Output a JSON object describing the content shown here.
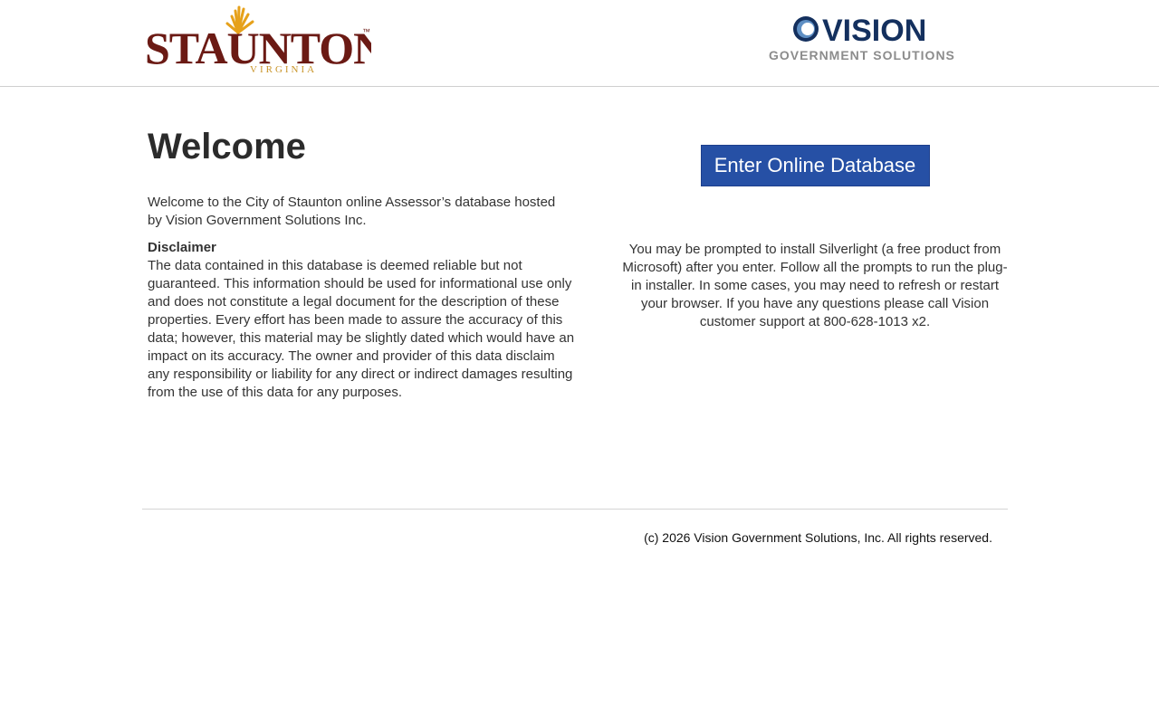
{
  "header": {
    "staunton_logo": {
      "text": "STAUNTON",
      "subtext": "VIRGINIA",
      "trademark": "™",
      "colors": {
        "primary": "#6b1a14",
        "accent": "#e6a11a"
      }
    },
    "vision_logo": {
      "text": "VISION",
      "subtext": "GOVERNMENT SOLUTIONS",
      "colors": {
        "primary": "#14305e",
        "secondary": "#8c8c8c",
        "ring_light": "#5e8fc4"
      }
    }
  },
  "main": {
    "title": "Welcome",
    "intro": "Welcome to the City of Staunton online Assessor’s database hosted by Vision Government Solutions Inc.",
    "disclaimer": {
      "heading": "Disclaimer",
      "body": "The data contained in this database is deemed reliable but not guaranteed. This information should be used for informational use only and does not constitute a legal document for the description of these properties. Every effort has been made to assure the accuracy of this data; however, this material may be slightly dated which would have an impact on its accuracy. The owner and provider of this data disclaim any responsibility or liability for any direct or indirect damages resulting from the use of this data for any purposes."
    },
    "enter_button": "Enter Online Database",
    "silverlight_note": "You may be prompted to install Silverlight (a free product from Microsoft) after you enter. Follow all the prompts to run the plug-in installer. In some cases, you may need to refresh or restart your browser. If you have any questions please call Vision customer support at 800-628-1013 x2."
  },
  "footer": {
    "copyright": "(c) 2026 Vision Government Solutions, Inc. All rights reserved."
  },
  "colors": {
    "button_bg": "#2650a5",
    "divider": "#d5d5d5"
  }
}
